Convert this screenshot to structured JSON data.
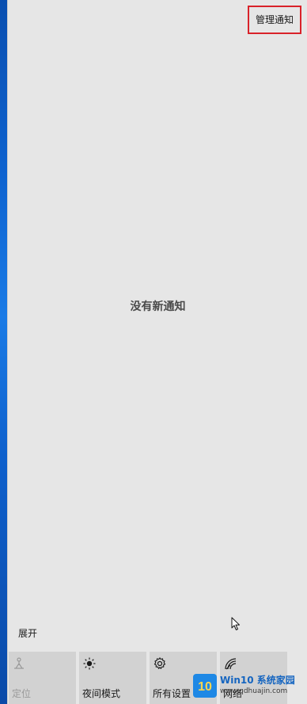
{
  "action_center": {
    "manage_notifications_label": "管理通知",
    "empty_message": "没有新通知",
    "expand_label": "展开"
  },
  "quick_actions": [
    {
      "label": "定位",
      "icon": "location-icon",
      "state": "disabled"
    },
    {
      "label": "夜间模式",
      "icon": "night-light-icon",
      "state": "off"
    },
    {
      "label": "所有设置",
      "icon": "gear-icon",
      "state": "off"
    },
    {
      "label": "网络",
      "icon": "network-icon",
      "state": "off"
    }
  ],
  "watermark": {
    "logo_text": "10",
    "brand": "Win10 系统家园",
    "url": "www.qdhuajin.com"
  },
  "colors": {
    "panel_bg": "#e6e6e6",
    "tile_bg": "#d2d2d2",
    "highlight_box": "#d9222a",
    "desktop_blue": "#0e63d0"
  }
}
